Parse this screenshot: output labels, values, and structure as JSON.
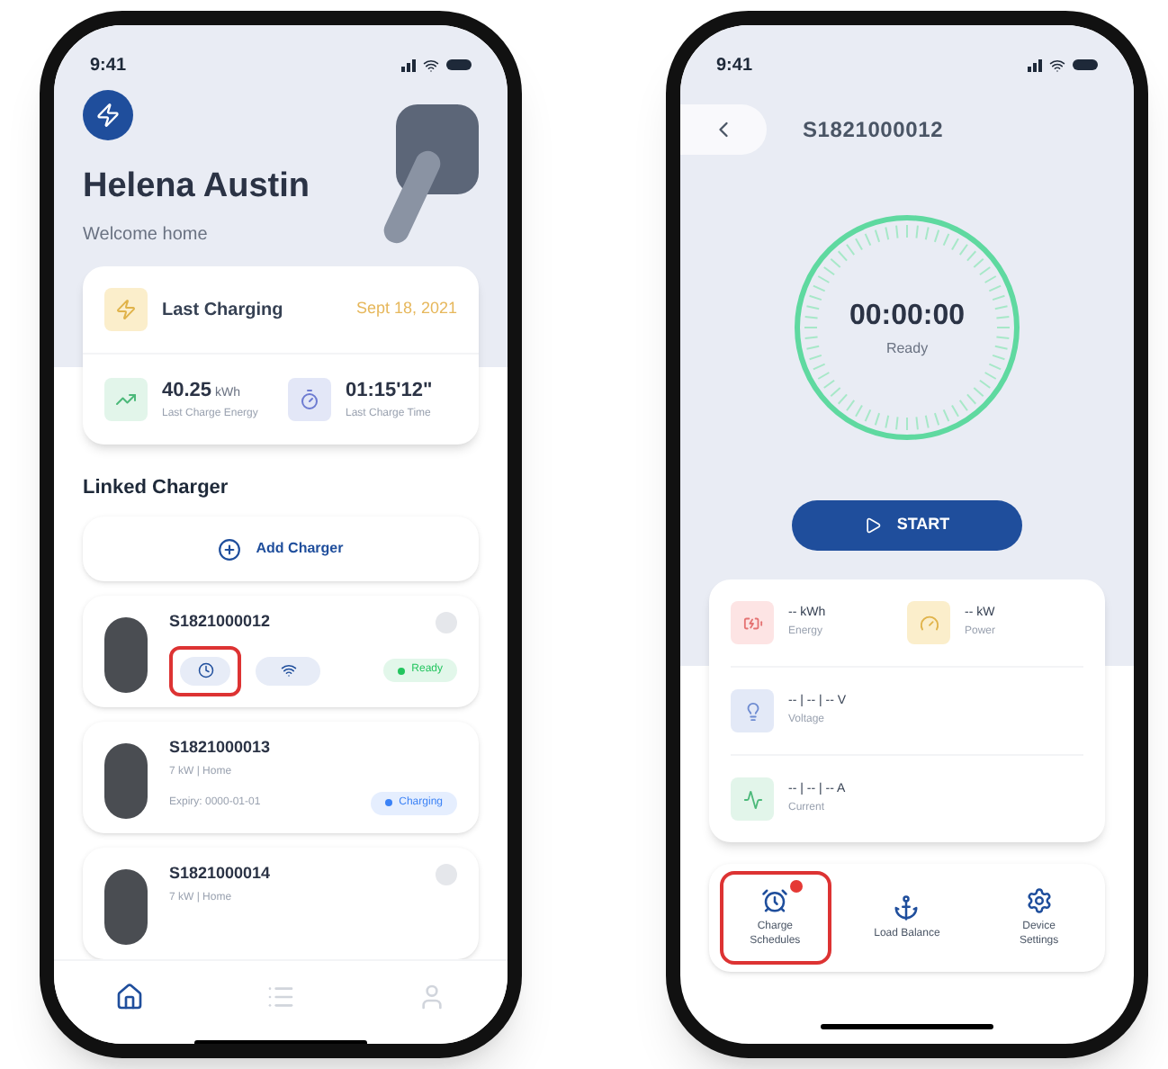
{
  "home_screen": {
    "status_time": "9:41",
    "user_name": "Helena Austin",
    "greeting": "Welcome home",
    "last_charging": {
      "label": "Last Charging",
      "date": "Sept 18, 2021"
    },
    "stats": [
      {
        "kind": "energy",
        "value": "40.25",
        "unit": "kWh",
        "label": "Last Charge Energy"
      },
      {
        "kind": "time",
        "value": "01:15'12\"",
        "label": "Last Charge Time"
      }
    ],
    "section_title": "Linked Charger",
    "add_button": "Add Charger",
    "chargers": [
      {
        "kind": "online",
        "serial": "S1821000012",
        "status": "Ready",
        "color": "#22c55e",
        "schedule_highlighted": true
      },
      {
        "kind": "expiry",
        "serial": "S1821000013",
        "subtitle": "7 kW | Home",
        "expiry": "Expiry: 0000-01-01",
        "status": "Charging",
        "color": "#3b82f6"
      },
      {
        "kind": "plain",
        "serial": "S1821000014",
        "subtitle": "7 kW | Home"
      }
    ],
    "tabs": [
      {
        "kind": "home",
        "selected": true
      },
      {
        "kind": "list",
        "selected": false
      },
      {
        "kind": "profile",
        "selected": false
      }
    ]
  },
  "charger_screen": {
    "status_time": "9:41",
    "title": "S1821000012",
    "timer": "00:00:00",
    "state": "Ready",
    "start_button": "START",
    "metrics": [
      {
        "kind": "energy",
        "value": "-- kWh",
        "label": "Energy"
      },
      {
        "kind": "power",
        "value": "-- kW",
        "label": "Power"
      },
      {
        "kind": "voltage",
        "value": "-- | -- | -- V",
        "label": "Voltage"
      },
      {
        "kind": "current",
        "value": "-- | -- | -- A",
        "label": "Current"
      }
    ],
    "actions": [
      {
        "kind": "schedule",
        "label": "Charge Schedules",
        "badge": true,
        "highlighted": true
      },
      {
        "kind": "balance",
        "label": "Load Balance",
        "badge": false,
        "highlighted": false
      },
      {
        "kind": "settings",
        "label": "Device Settings",
        "badge": false,
        "highlighted": false
      }
    ]
  }
}
